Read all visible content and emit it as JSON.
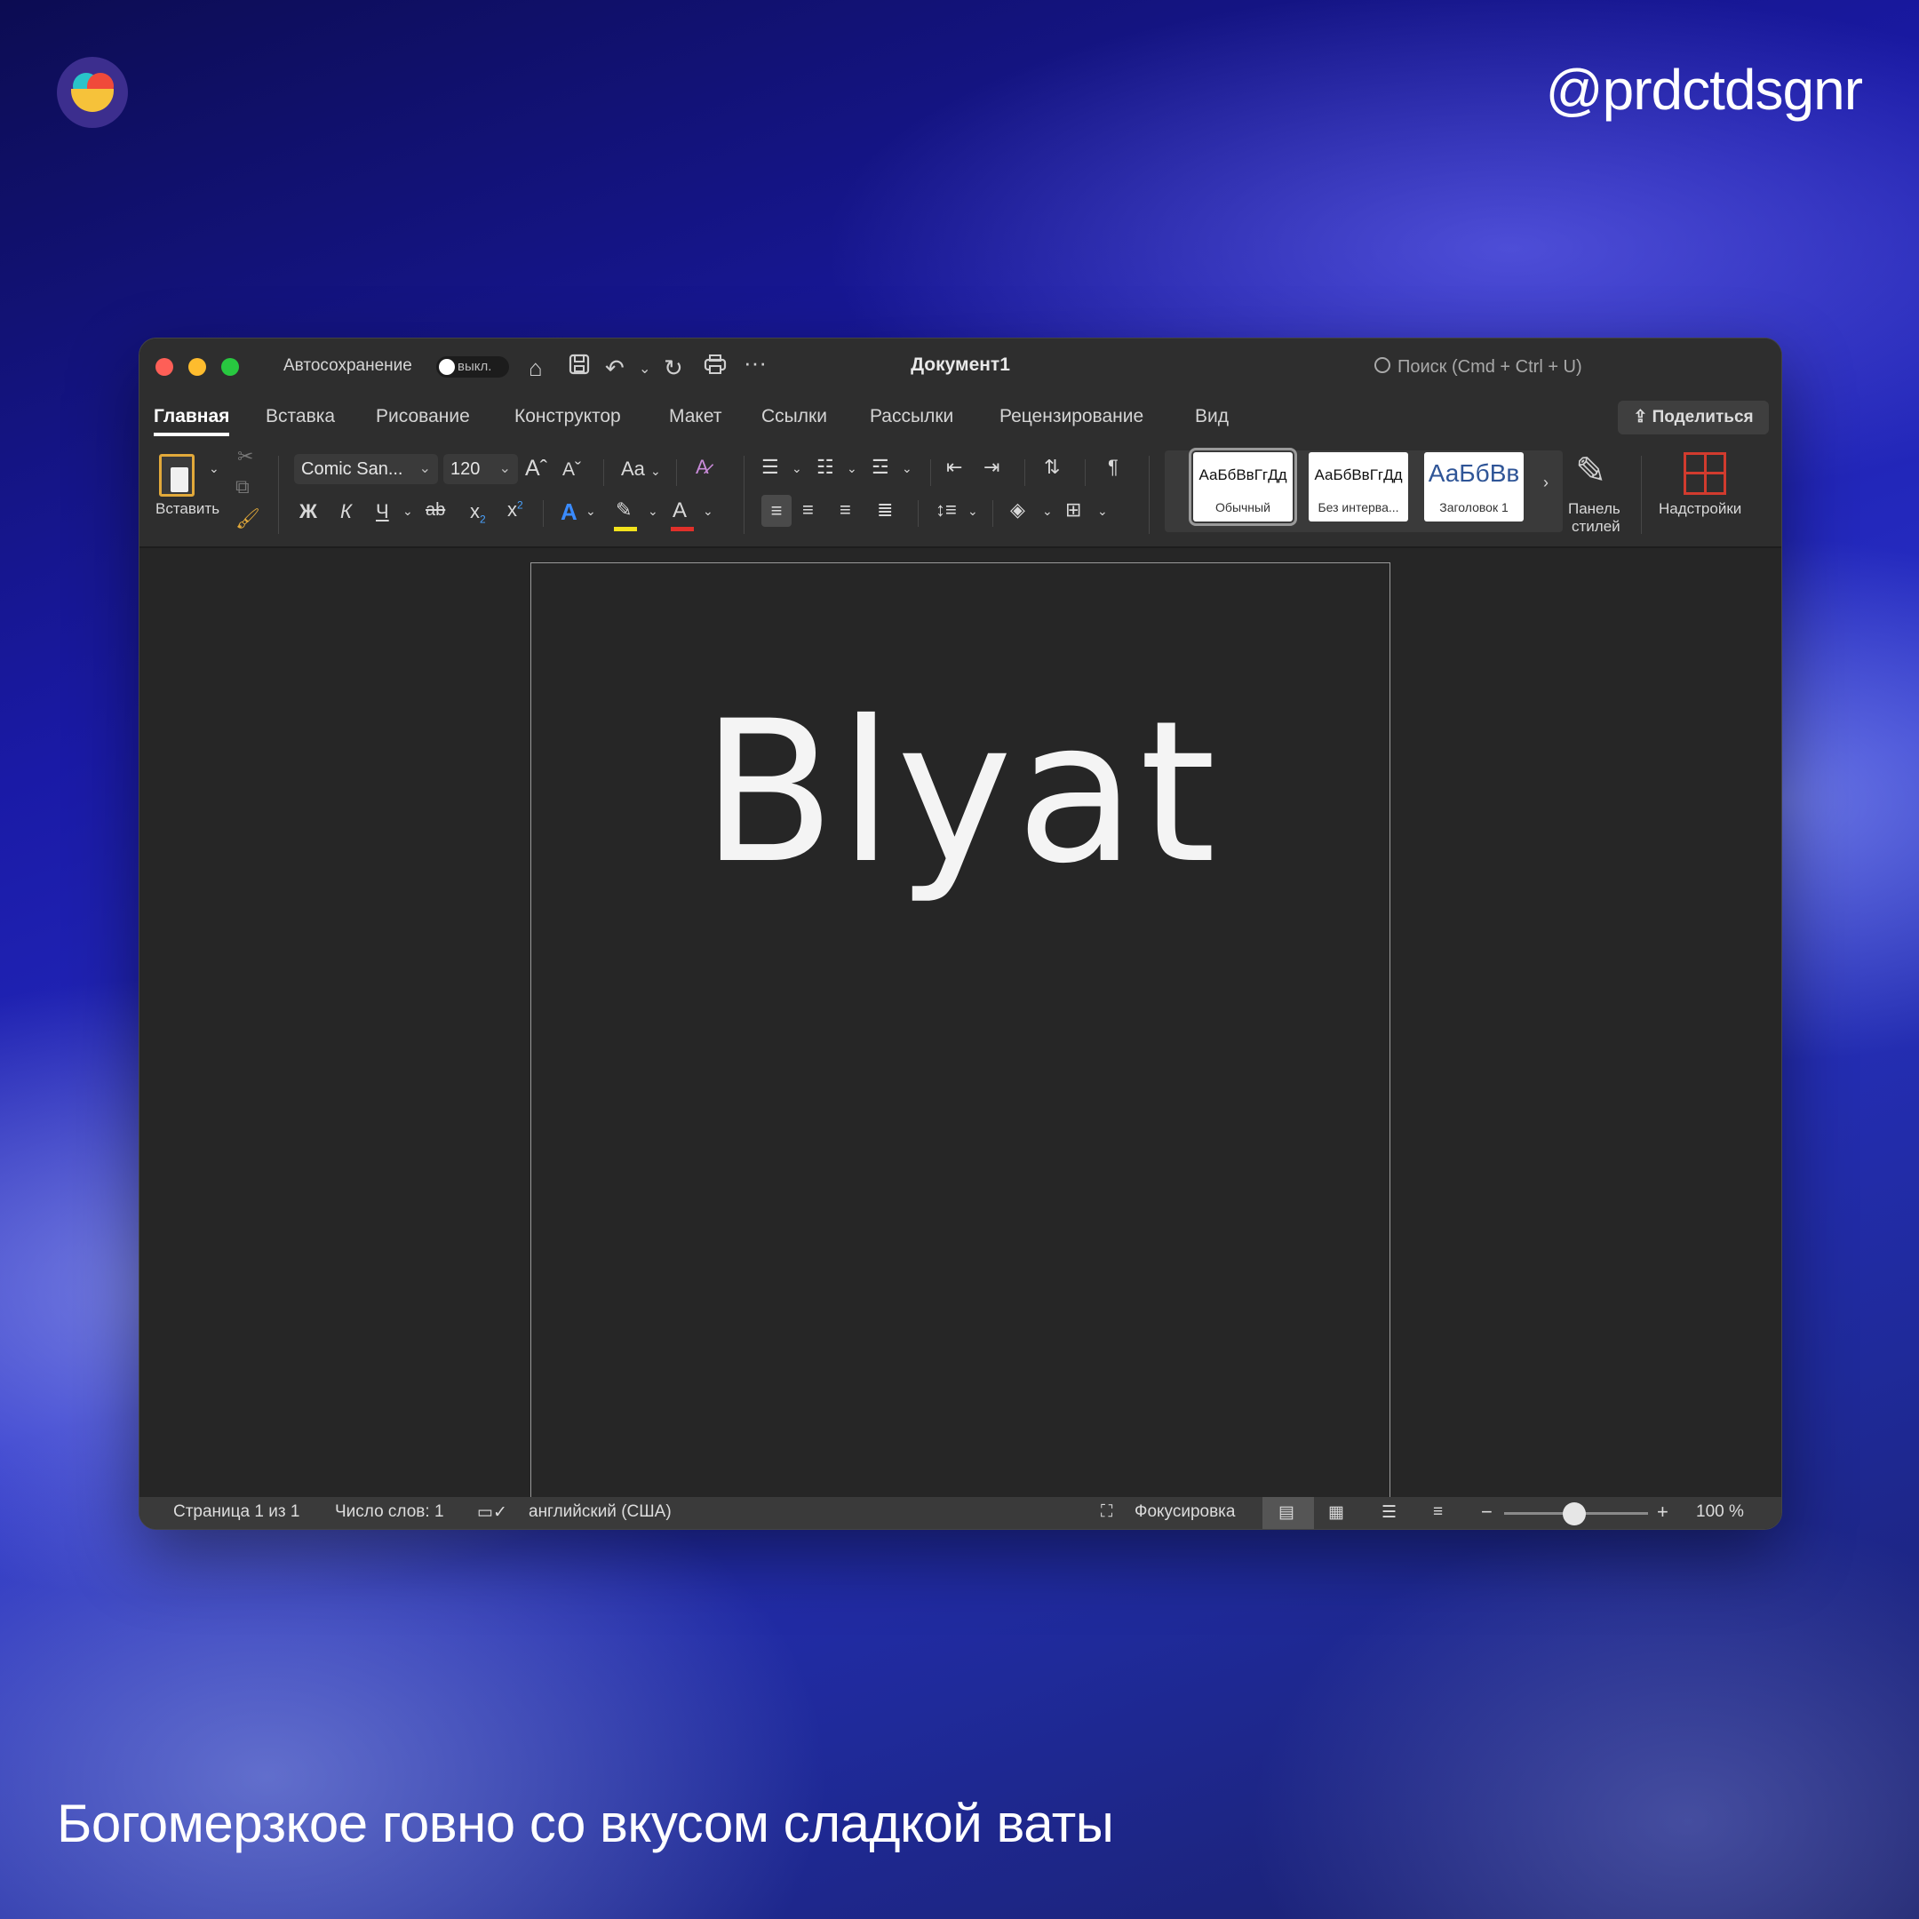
{
  "handle": "@prdctdsgnr",
  "caption": "Богомерзкое говно со вкусом сладкой ваты",
  "window": {
    "autosave_label": "Автосохранение",
    "autosave_state": "выкл.",
    "doc_title": "Документ1",
    "search_placeholder": "Поиск (Cmd + Ctrl + U)",
    "share_label": "Поделиться"
  },
  "tabs": [
    "Главная",
    "Вставка",
    "Рисование",
    "Конструктор",
    "Макет",
    "Ссылки",
    "Рассылки",
    "Рецензирование",
    "Вид"
  ],
  "active_tab": "Главная",
  "ribbon": {
    "paste_label": "Вставить",
    "font_name": "Comic San...",
    "font_size": "120",
    "grow_font": "A",
    "shrink_font": "A",
    "change_case": "Aa",
    "bold": "Ж",
    "italic": "К",
    "underline": "Ч",
    "strike": "ab",
    "subscript": "x",
    "superscript": "x",
    "pilcrow": "¶",
    "styles": [
      {
        "sample": "АаБбВвГгДд",
        "name": "Обычный"
      },
      {
        "sample": "АаБбВвГгДд",
        "name": "Без интерва..."
      },
      {
        "sample": "АаБбВв",
        "name": "Заголовок 1"
      }
    ],
    "styles_pane_line1": "Панель",
    "styles_pane_line2": "стилей",
    "addins_label": "Надстройки",
    "highlight_color": "#f2e21c",
    "font_color": "#e0302a"
  },
  "document": {
    "text": "Blyat"
  },
  "status": {
    "page": "Страница 1 из 1",
    "words": "Число слов: 1",
    "language": "английский (США)",
    "focus": "Фокусировка",
    "zoom": "100 %",
    "zoom_minus": "−",
    "zoom_plus": "+",
    "zoom_fraction": 0.5
  }
}
